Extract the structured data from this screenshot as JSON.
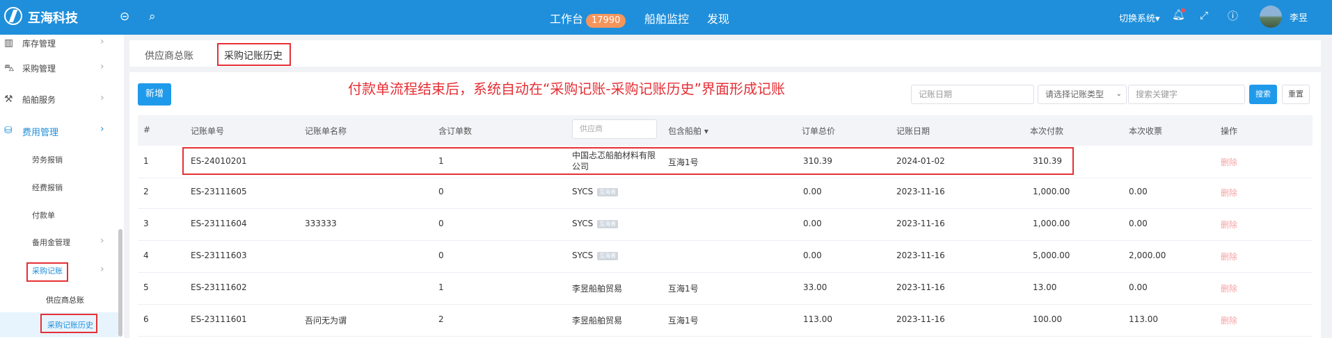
{
  "header": {
    "brand": "互海科技",
    "nav": {
      "workbench": "工作台",
      "workbench_badge": "17990",
      "ship_monitor": "船舶监控",
      "discover": "发现"
    },
    "switch_system": "切换系统",
    "user_name": "李昱"
  },
  "sidebar": {
    "items": [
      {
        "label": "库存管理"
      },
      {
        "label": "采购管理"
      },
      {
        "label": "船舶服务"
      },
      {
        "label": "费用管理"
      }
    ],
    "sub_items": [
      {
        "label": "劳务报销"
      },
      {
        "label": "经费报销"
      },
      {
        "label": "付款单"
      },
      {
        "label": "备用金管理"
      },
      {
        "label": "采购记账"
      }
    ],
    "sub_sub_items": [
      {
        "label": "供应商总账"
      },
      {
        "label": "采购记账历史"
      }
    ]
  },
  "tabs": [
    {
      "label": "供应商总账"
    },
    {
      "label": "采购记账历史"
    }
  ],
  "toolbar": {
    "add_label": "新增",
    "annotation": "付款单流程结束后，系统自动在“采购记账-采购记账历史”界面形成记账",
    "date_placeholder": "记账日期",
    "type_placeholder": "请选择记账类型",
    "keyword_placeholder": "搜索关键字",
    "search_label": "搜索",
    "reset_label": "重置"
  },
  "table": {
    "columns": [
      "#",
      "记账单号",
      "记账单名称",
      "含订单数",
      "供应商",
      "包含船舶",
      "订单总价",
      "记账日期",
      "本次付款",
      "本次收票",
      "操作"
    ],
    "supplier_placeholder": "供应商",
    "rows": [
      {
        "no": "1",
        "code": "ES-24010201",
        "name": "",
        "orders": "1",
        "supplier": "中国忐忑船舶材料有限公司",
        "tag": "",
        "ship": "互海1号",
        "total": "310.39",
        "date": "2024-01-02",
        "pay": "310.39",
        "receipt": "",
        "action": "删除"
      },
      {
        "no": "2",
        "code": "ES-23111605",
        "name": "",
        "orders": "0",
        "supplier": "SYCS",
        "tag": "互海者",
        "ship": "",
        "total": "0.00",
        "date": "2023-11-16",
        "pay": "1,000.00",
        "receipt": "0.00",
        "action": "删除"
      },
      {
        "no": "3",
        "code": "ES-23111604",
        "name": "333333",
        "orders": "0",
        "supplier": "SYCS",
        "tag": "互海者",
        "ship": "",
        "total": "0.00",
        "date": "2023-11-16",
        "pay": "1,000.00",
        "receipt": "0.00",
        "action": "删除"
      },
      {
        "no": "4",
        "code": "ES-23111603",
        "name": "",
        "orders": "0",
        "supplier": "SYCS",
        "tag": "互海者",
        "ship": "",
        "total": "0.00",
        "date": "2023-11-16",
        "pay": "5,000.00",
        "receipt": "2,000.00",
        "action": "删除"
      },
      {
        "no": "5",
        "code": "ES-23111602",
        "name": "",
        "orders": "1",
        "supplier": "李昱船舶贸易",
        "tag": "",
        "ship": "互海1号",
        "total": "33.00",
        "date": "2023-11-16",
        "pay": "13.00",
        "receipt": "0.00",
        "action": "删除"
      },
      {
        "no": "6",
        "code": "ES-23111601",
        "name": "吾问无为谓",
        "orders": "2",
        "supplier": "李昱船舶贸易",
        "tag": "",
        "ship": "互海1号",
        "total": "113.00",
        "date": "2023-11-16",
        "pay": "100.00",
        "receipt": "113.00",
        "action": "删除"
      }
    ]
  }
}
